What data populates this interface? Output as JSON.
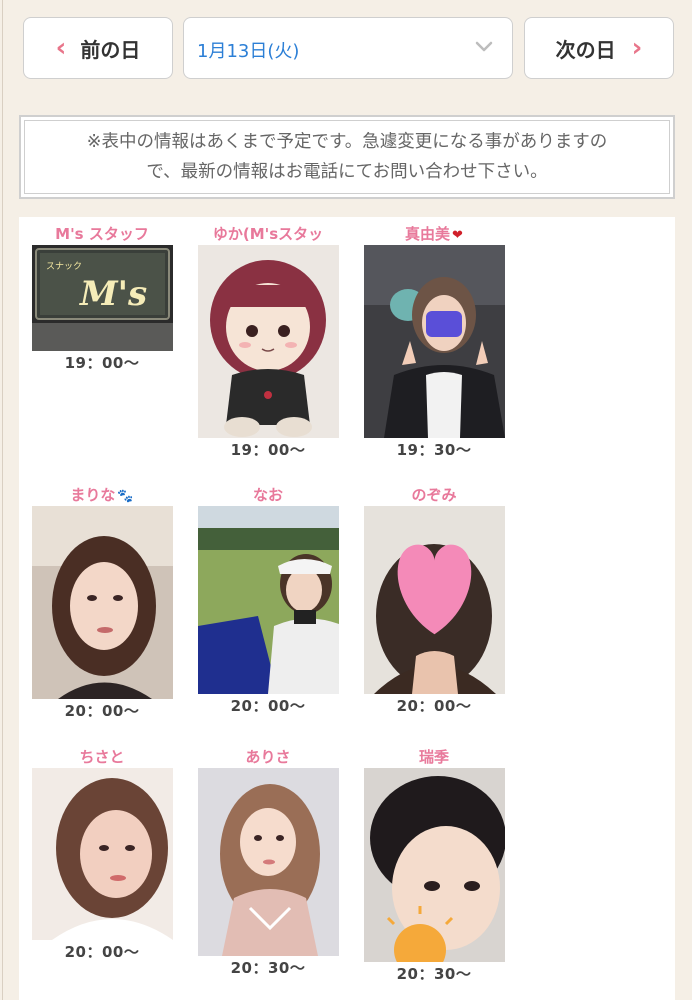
{
  "nav": {
    "prev_label": "前の日",
    "next_label": "次の日",
    "date_value": "1月13日(火)"
  },
  "notice": {
    "line1": "※表中の情報はあくまで予定です。急遽変更になる事がありますの",
    "line2": "で、最新の情報はお電話にてお問い合わせ下さい。"
  },
  "casts": [
    {
      "name": "M's スタッフ",
      "time": "19：00〜",
      "emoji": ""
    },
    {
      "name": "ゆか(M'sスタッ",
      "time": "19：00〜",
      "emoji": ""
    },
    {
      "name": "真由美",
      "time": "19：30〜",
      "emoji": "❤"
    },
    {
      "name": "まりな",
      "time": "20：00〜",
      "emoji": "🐾"
    },
    {
      "name": "なお",
      "time": "20：00〜",
      "emoji": ""
    },
    {
      "name": "のぞみ",
      "time": "20：00〜",
      "emoji": ""
    },
    {
      "name": "ちさと",
      "time": "20：00〜",
      "emoji": ""
    },
    {
      "name": "ありさ",
      "time": "20：30〜",
      "emoji": ""
    },
    {
      "name": "瑞季",
      "time": "20：30〜",
      "emoji": ""
    }
  ],
  "store_sign": {
    "small_text": "スナック",
    "logo_text": "M's"
  },
  "colors": {
    "accent_pink": "#e8799b",
    "chevron": "#e8758a",
    "date_blue": "#2c7fd6",
    "background": "#f5efe6"
  }
}
